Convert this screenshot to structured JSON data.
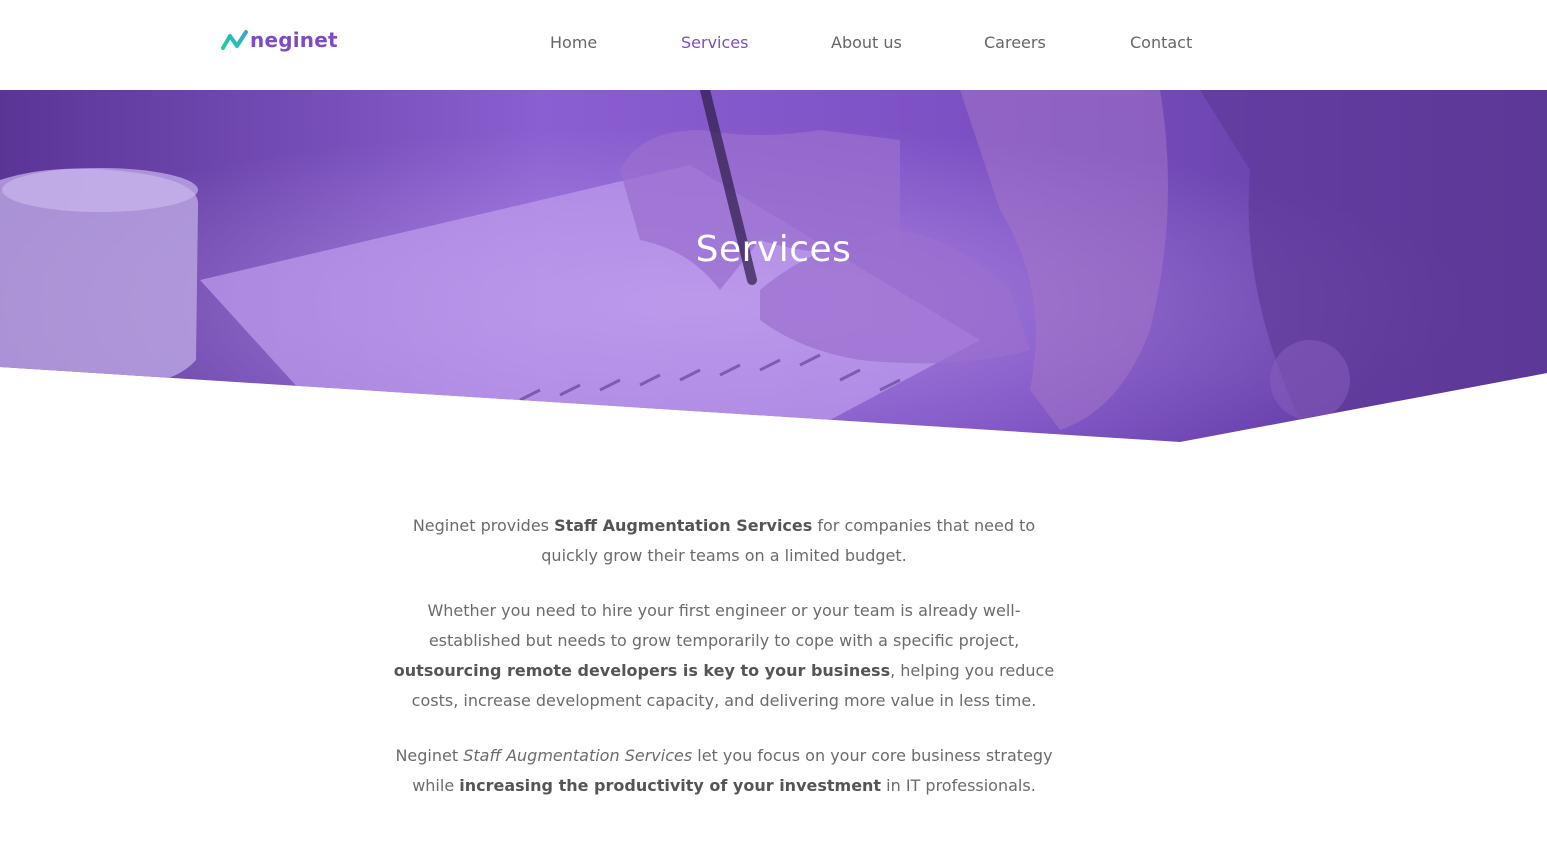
{
  "brand": {
    "name": "neginet",
    "logo_icon": "zigzag-arrow-logo",
    "primary_color": "#7b4cc4",
    "accent_color": "#28c6a0"
  },
  "nav": {
    "items": [
      {
        "label": "Home",
        "active": false
      },
      {
        "label": "Services",
        "active": true
      },
      {
        "label": "About us",
        "active": false
      },
      {
        "label": "Careers",
        "active": false
      },
      {
        "label": "Contact",
        "active": false
      }
    ]
  },
  "hero": {
    "title": "Services",
    "overlay_color": "#6a3fb0"
  },
  "content": {
    "p1": {
      "t1": "Neginet provides ",
      "b1": "Staff Augmentation Services",
      "t2": " for companies that need to quickly grow their teams on a limited budget."
    },
    "p2": {
      "t1": "Whether you need to hire your first engineer or your team is already well-established but needs to grow temporarily to cope with a specific project, ",
      "b1": "outsourcing remote developers is key to your business",
      "t2": ", helping you reduce costs, increase development capacity, and delivering more value in less time."
    },
    "p3": {
      "t1": "Neginet ",
      "i1": "Staff Augmentation Services",
      "t2": " let you focus on your core business strategy while ",
      "b1": "increasing the productivity of your investment",
      "t3": " in IT professionals."
    }
  }
}
